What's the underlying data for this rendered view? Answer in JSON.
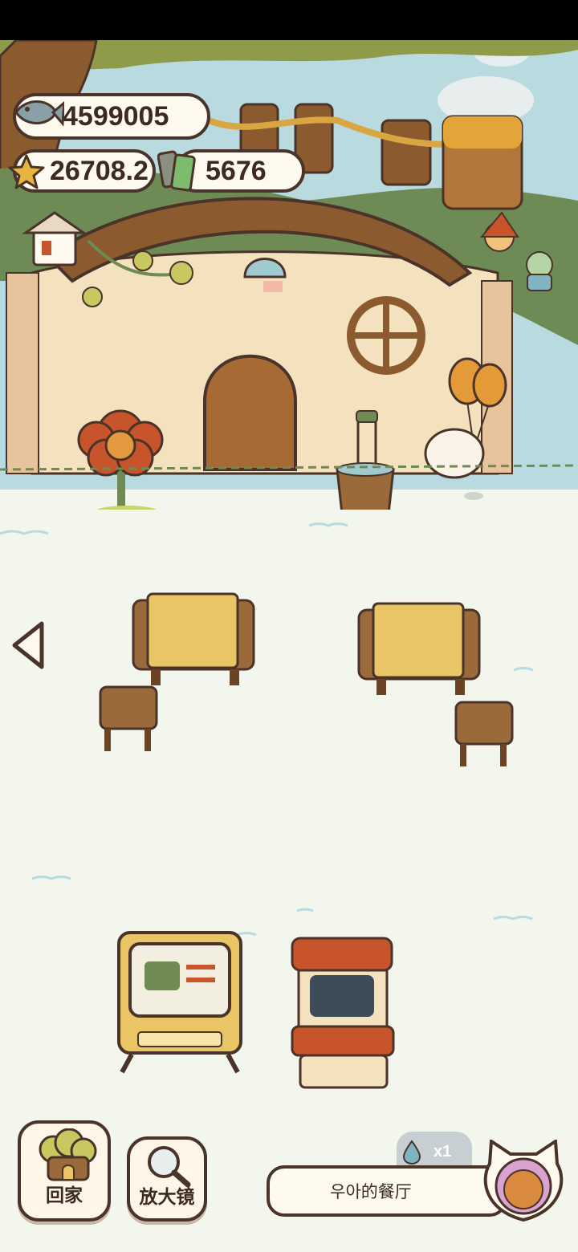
{
  "resources": {
    "fish": {
      "value": "4599005",
      "icon": "fish-icon"
    },
    "stars": {
      "value": "26708.2",
      "icon": "star-icon"
    },
    "batteries": {
      "value": "5676",
      "icon": "battery-icon"
    }
  },
  "buttons": {
    "home_label": "回家",
    "magnifier_label": "放大镜"
  },
  "restaurant": {
    "name": "우아的餐厅",
    "water_count": "x1"
  },
  "colors": {
    "floor": "#f2f6ec",
    "outline": "#4a3329",
    "wood": "#9b6a3a",
    "cloth": "#e9c566",
    "flower": "#c8542b",
    "grass": "#6f8a52"
  }
}
